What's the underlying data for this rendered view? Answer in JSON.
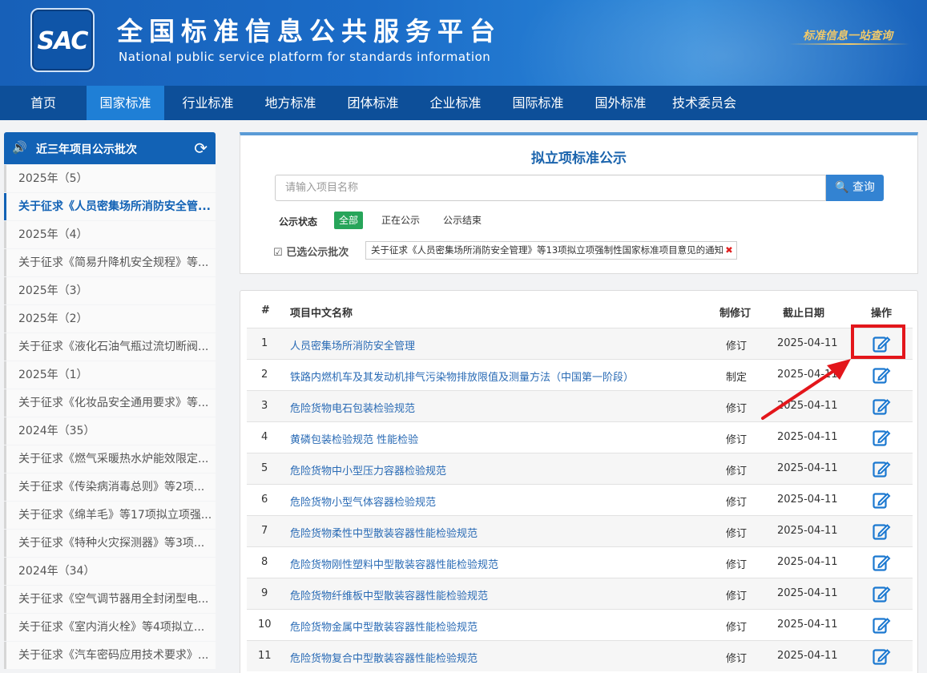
{
  "header": {
    "logo_text": "SAC",
    "title": "全国标准信息公共服务平台",
    "subtitle": "National public service platform  for standards information",
    "slogan": "标准信息一站查询"
  },
  "nav": [
    "首页",
    "国家标准",
    "行业标准",
    "地方标准",
    "团体标准",
    "企业标准",
    "国际标准",
    "国外标准",
    "技术委员会"
  ],
  "sidebar": {
    "title": "近三年项目公示批次",
    "items": [
      "2025年（5）",
      "关于征求《人员密集场所消防安全管...",
      "2025年（4）",
      "关于征求《简易升降机安全规程》等...",
      "2025年（3）",
      "2025年（2）",
      "关于征求《液化石油气瓶过流切断阀...",
      "2025年（1）",
      "关于征求《化妆品安全通用要求》等...",
      "2024年（35）",
      "关于征求《燃气采暖热水炉能效限定...",
      "关于征求《传染病消毒总则》等2项...",
      "关于征求《绵羊毛》等17项拟立项强...",
      "关于征求《特种火灾探测器》等3项...",
      "2024年（34）",
      "关于征求《空气调节器用全封闭型电...",
      "关于征求《室内消火栓》等4项拟立...",
      "关于征求《汽车密码应用技术要求》..."
    ]
  },
  "search_panel": {
    "title": "拟立项标准公示",
    "placeholder": "请输入项目名称",
    "search_button": "查询",
    "status_label": "公示状态",
    "status_options": [
      "全部",
      "正在公示",
      "公示结束"
    ],
    "selected_label": "已选公示批次",
    "selected_tag": "关于征求《人员密集场所消防安全管理》等13项拟立项强制性国家标准项目意见的通知"
  },
  "table": {
    "headers": [
      "#",
      "项目中文名称",
      "制修订",
      "截止日期",
      "操作"
    ],
    "rows": [
      [
        "1",
        "人员密集场所消防安全管理",
        "修订",
        "2025-04-11"
      ],
      [
        "2",
        "铁路内燃机车及其发动机排气污染物排放限值及测量方法（中国第一阶段）",
        "制定",
        "2025-04-11"
      ],
      [
        "3",
        "危险货物电石包装检验规范",
        "修订",
        "2025-04-11"
      ],
      [
        "4",
        "黄磷包装检验规范 性能检验",
        "修订",
        "2025-04-11"
      ],
      [
        "5",
        "危险货物中小型压力容器检验规范",
        "修订",
        "2025-04-11"
      ],
      [
        "6",
        "危险货物小型气体容器检验规范",
        "修订",
        "2025-04-11"
      ],
      [
        "7",
        "危险货物柔性中型散装容器性能检验规范",
        "修订",
        "2025-04-11"
      ],
      [
        "8",
        "危险货物刚性塑料中型散装容器性能检验规范",
        "修订",
        "2025-04-11"
      ],
      [
        "9",
        "危险货物纤维板中型散装容器性能检验规范",
        "修订",
        "2025-04-11"
      ],
      [
        "10",
        "危险货物金属中型散装容器性能检验规范",
        "修订",
        "2025-04-11"
      ],
      [
        "11",
        "危险货物复合中型散装容器性能检验规范",
        "修订",
        "2025-04-11"
      ]
    ]
  },
  "colors": {
    "brand": "#1262b5",
    "nav": "#0d4f99",
    "active_chip": "#27a55a",
    "highlight": "#e3161b"
  }
}
